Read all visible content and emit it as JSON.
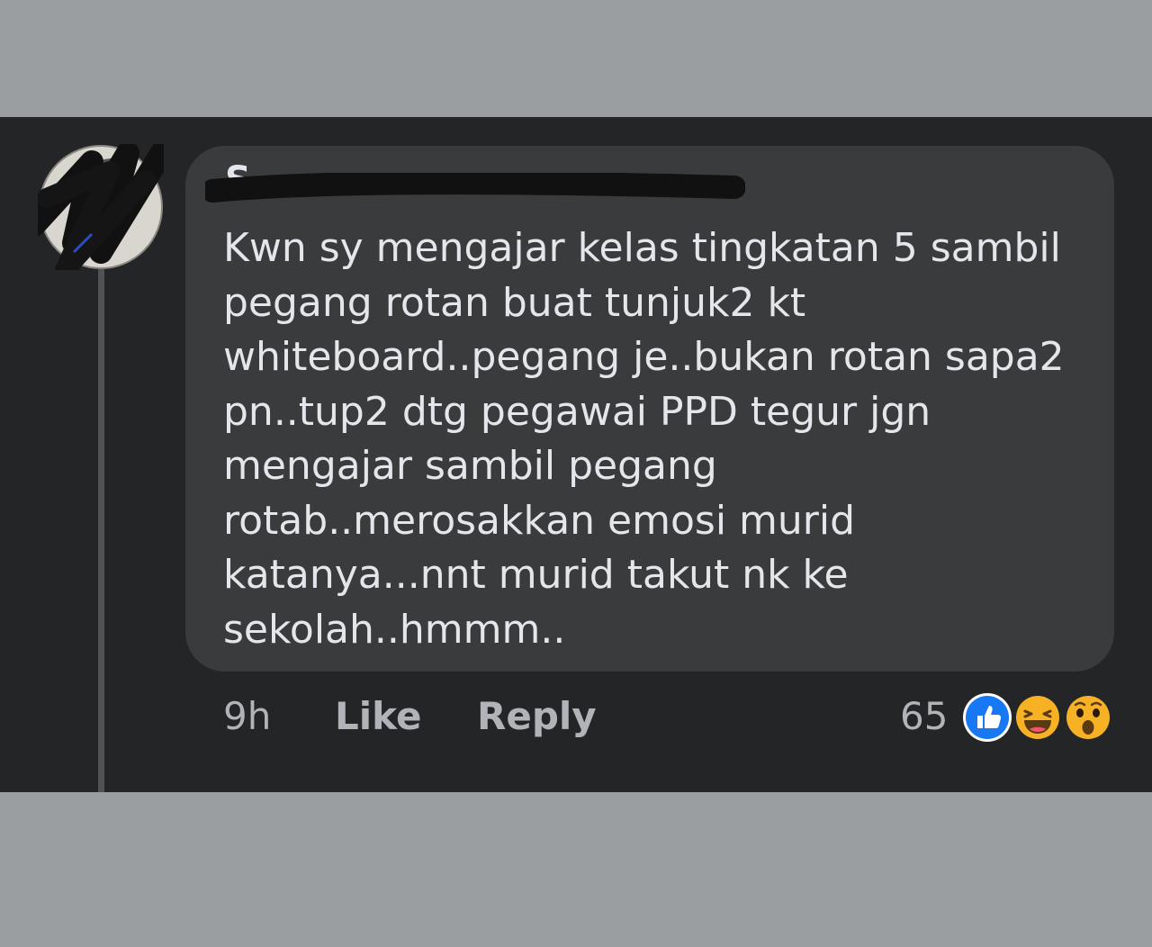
{
  "comment": {
    "author": "S",
    "lines": [
      "Kwn sy mengajar kelas tingkatan 5 sambil",
      "pegang rotan buat tunjuk2 kt",
      "whiteboard..pegang je..bukan rotan sapa2",
      "pn..tup2 dtg pegawai PPD tegur jgn",
      "mengajar sambil pegang",
      "rotab..merosakkan emosi murid",
      "katanya...nnt murid takut nk ke",
      "sekolah..hmmm.."
    ]
  },
  "actions": {
    "time": "9h",
    "like_label": "Like",
    "reply_label": "Reply"
  },
  "reactions": {
    "count": "65",
    "icons": [
      "like-reaction-icon",
      "haha-reaction-icon",
      "wow-reaction-icon"
    ],
    "colors": {
      "like": "#1877f2",
      "haha": "#f7b125",
      "wow": "#f7b125"
    }
  },
  "colors": {
    "background_outer": "#9b9ea1",
    "panel": "#242527",
    "bubble": "#3a3b3d",
    "text_primary": "#e4e6eb",
    "text_secondary": "#b0b3b8"
  }
}
